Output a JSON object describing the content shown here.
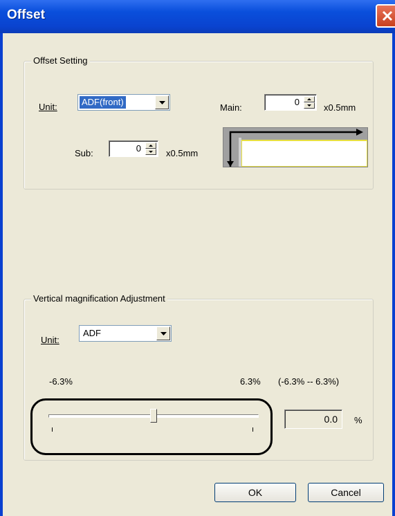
{
  "window": {
    "title": "Offset"
  },
  "offset_group": {
    "legend": "Offset Setting",
    "unit_label": "Unit:",
    "unit_value": "ADF(front)",
    "main_label": "Main:",
    "main_value": "0",
    "main_suffix": "x0.5mm",
    "sub_label": "Sub:",
    "sub_value": "0",
    "sub_suffix": "x0.5mm"
  },
  "magnification_group": {
    "legend": "Vertical magnification Adjustment",
    "unit_label": "Unit:",
    "unit_value": "ADF",
    "min_label": "-6.3%",
    "max_label": "6.3%",
    "range_label": "(-6.3% -- 6.3%)",
    "value": "0.0",
    "percent_symbol": "%",
    "slider_fraction": 0.5
  },
  "buttons": {
    "ok": "OK",
    "cancel": "Cancel"
  },
  "colors": {
    "title_bar": "#0a4fdc",
    "selection": "#316ac5",
    "face": "#ece9d8",
    "close": "#e0522c"
  },
  "icons": [
    "close-icon",
    "chevron-down-icon",
    "spin-up-icon",
    "spin-down-icon"
  ]
}
